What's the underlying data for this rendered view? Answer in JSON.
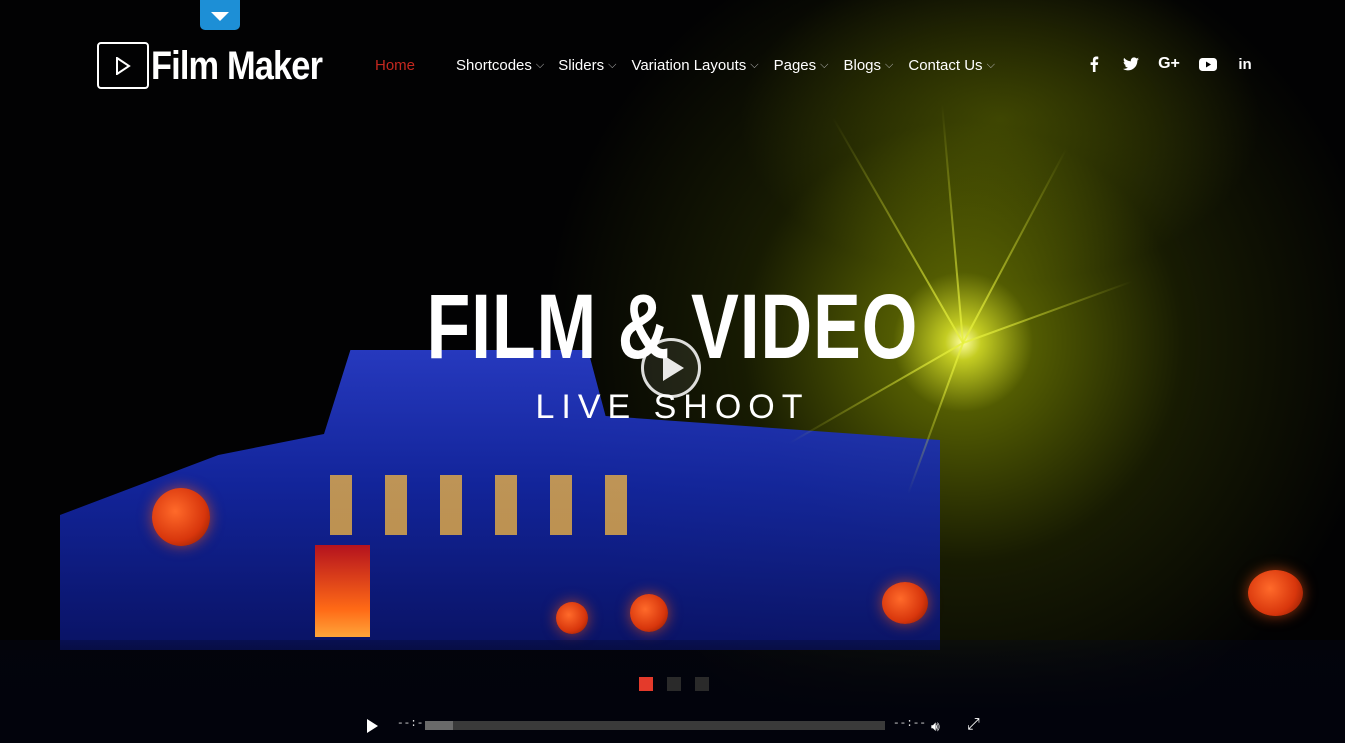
{
  "header": {
    "logo_text": "Film Maker",
    "nav": [
      {
        "label": "Home",
        "active": true,
        "dropdown": false
      },
      {
        "label": "Shortcodes",
        "dropdown": true
      },
      {
        "label": "Sliders",
        "dropdown": true
      },
      {
        "label": "Variation Layouts",
        "dropdown": true
      },
      {
        "label": "Pages",
        "dropdown": true
      },
      {
        "label": "Blogs",
        "dropdown": true
      },
      {
        "label": "Contact Us",
        "dropdown": true
      }
    ],
    "social": [
      {
        "name": "facebook-icon",
        "glyph": "f"
      },
      {
        "name": "twitter-icon",
        "glyph": "🐦"
      },
      {
        "name": "google-plus-icon",
        "glyph": "G+"
      },
      {
        "name": "youtube-icon",
        "glyph": "▶"
      },
      {
        "name": "linkedin-icon",
        "glyph": "in"
      }
    ]
  },
  "hero": {
    "title": "FILM & VIDEO",
    "subtitle": "LIVE SHOOT",
    "slides": 3,
    "active_slide": 1
  },
  "player": {
    "current_time": "--:--",
    "duration": "--:--",
    "progress": 0.06
  },
  "colors": {
    "accent": "#e43a2b",
    "nav_active": "#c4281f",
    "toggle_tab": "#1d8fd6"
  }
}
